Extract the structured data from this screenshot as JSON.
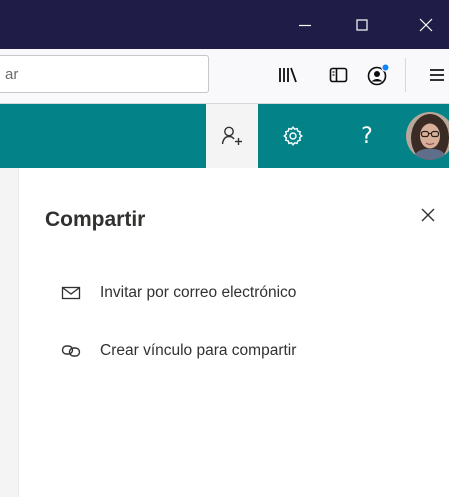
{
  "window": {
    "controls": [
      "minimize",
      "maximize",
      "close"
    ]
  },
  "browser": {
    "urlbar": {
      "visible_text": "ar"
    },
    "toolbar_icons": [
      "library-icon",
      "sidebar-icon",
      "account-icon",
      "menu-icon"
    ],
    "account_badge_color": "#0a84ff"
  },
  "suitebar": {
    "background": "#038387",
    "buttons": [
      "share-person-add-icon",
      "gear-icon",
      "help-icon",
      "avatar"
    ],
    "help_glyph": "?"
  },
  "share_panel": {
    "title": "Compartir",
    "options": [
      {
        "label": "Invitar por correo electrónico",
        "icon": "mail-icon"
      },
      {
        "label": "Crear vínculo para compartir",
        "icon": "link-icon"
      }
    ]
  }
}
